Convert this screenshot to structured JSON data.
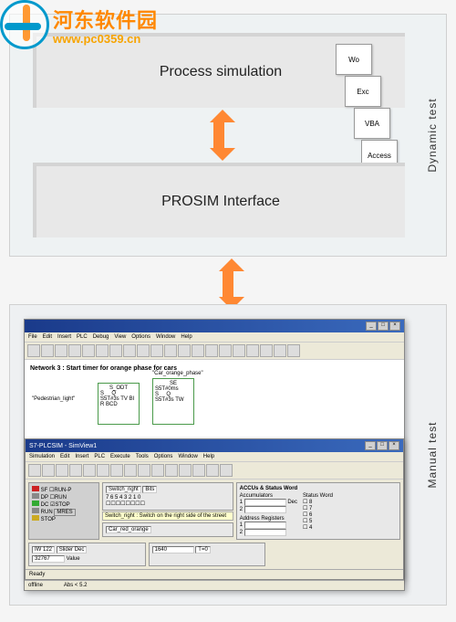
{
  "watermark": {
    "cn": "河东软件园",
    "url": "www.pc0359.cn"
  },
  "sections": {
    "top": {
      "label": "Dynamic test"
    },
    "bottom": {
      "label": "Manual test"
    }
  },
  "boxes": {
    "process": "Process simulation",
    "prosim": "PROSIM Interface"
  },
  "apps": {
    "word": "Wo",
    "excel": "Exc",
    "vba": "VBA",
    "access": "Access"
  },
  "editor_window": {
    "menus": [
      "File",
      "Edit",
      "Insert",
      "PLC",
      "Debug",
      "View",
      "Options",
      "Window",
      "Help"
    ],
    "network_title": "Network 3 : Start timer for orange phase for cars",
    "io_left": "\"Pedestrian_light\"",
    "io_time": "S5T#3s",
    "io_tv": "S5T#3s",
    "io_bi": "TW",
    "op1": "S_ODT",
    "op2": "SE",
    "right_var": "\"Car_orange_phase\"",
    "right_val": "S5T#0ms"
  },
  "sim_window": {
    "title": "S7-PLCSIM - SimView1",
    "menus": [
      "Simulation",
      "Edit",
      "Insert",
      "PLC",
      "Execute",
      "Tools",
      "Options",
      "Window",
      "Help"
    ],
    "cpu_labels": [
      "SF",
      "DP",
      "DC",
      "RUN",
      "STOP"
    ],
    "run_modes": [
      "RUN-P",
      "RUN",
      "STOP",
      "MRES"
    ],
    "switch_label": "Switch_right",
    "switch_type": "Bits",
    "var_label": "Car_red_orange",
    "iw": "IW 122",
    "iw_type": "Slider Dec",
    "iw_val": "32767",
    "mw": "Value",
    "mw_val": "1640",
    "mw_t": "T=0",
    "acc_title": "ACCUs & Status Word",
    "acc_label": "Accumulators",
    "status_label": "Status Word",
    "tip": "Switch_right : Switch on the right side of the street",
    "addr_reg": "Address Registers",
    "dec": "Dec",
    "nums": [
      "1",
      "2"
    ],
    "ready": "Ready"
  },
  "statusbar_editor": {
    "mode": "offline",
    "extra": "Abs < 5.2"
  }
}
